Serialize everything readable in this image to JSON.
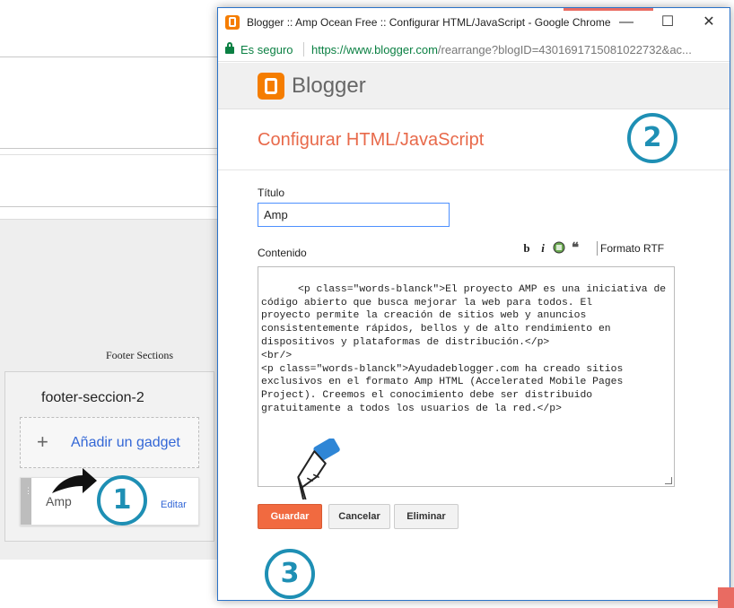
{
  "window": {
    "title": "Blogger :: Amp Ocean Free :: Configurar HTML/JavaScript - Google Chrome",
    "minimize_glyph": "—",
    "maximize_glyph": "☐",
    "close_glyph": "✕"
  },
  "address_bar": {
    "secure_label": "Es seguro",
    "url_host": "https://www.blogger.com",
    "url_rest": "/rearrange?blogID=4301691715081022732&ac..."
  },
  "app": {
    "brand": "Blogger"
  },
  "dialog": {
    "title": "Configurar HTML/JavaScript",
    "title_label": "Título",
    "title_value": "Amp",
    "content_label": "Contenido",
    "toolbar": {
      "bold": "b",
      "italic": "i",
      "rich_text": "Formato RTF"
    },
    "content_value": "<p class=\"words-blanck\">El proyecto AMP es una iniciativa de\ncódigo abierto que busca mejorar la web para todos. El\nproyecto permite la creación de sitios web y anuncios\nconsistentemente rápidos, bellos y de alto rendimiento en\ndispositivos y plataformas de distribución.</p>\n<br/>\n<p class=\"words-blanck\">Ayudadeblogger.com ha creado sitios\nexclusivos en el formato Amp HTML (Accelerated Mobile Pages\nProject). Creemos el conocimiento debe ser distribuido\ngratuitamente a todos los usuarios de la red.</p>",
    "buttons": {
      "save": "Guardar",
      "cancel": "Cancelar",
      "delete": "Eliminar"
    }
  },
  "layout_page": {
    "section_heading": "Footer Sections",
    "section_name": "footer-seccion-2",
    "add_gadget_plus": "+",
    "add_gadget_label": "Añadir un gadget",
    "gadget_name": "Amp",
    "gadget_edit": "Editar"
  },
  "annotations": [
    "1",
    "2",
    "3"
  ],
  "colors": {
    "accent_orange": "#f57d00",
    "title_orange": "#e8694a",
    "save_button": "#f16a40",
    "annotation_blue": "#1e8fb4",
    "link_blue": "#3367d6",
    "secure_green": "#0b8043"
  }
}
